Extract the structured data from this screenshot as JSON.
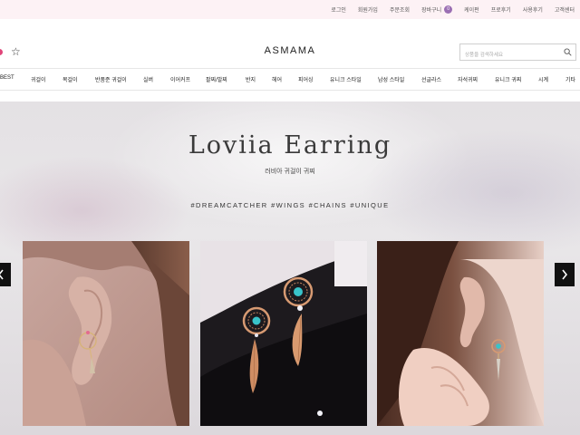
{
  "topbar": {
    "links": [
      "로그인",
      "회원가입",
      "주문조회",
      "장바구니",
      "케이펀",
      "프로후기",
      "사용후기",
      "고객센터"
    ],
    "cart_count": "0"
  },
  "header": {
    "logo": "ASMAMA",
    "search_placeholder": "상품을 검색하세요"
  },
  "nav": {
    "items": [
      "BEST",
      "귀걸이",
      "목걸이",
      "반품준 귀걸이",
      "실버",
      "이어커프",
      "팔찌/발찌",
      "반지",
      "헤어",
      "피어싱",
      "유니크 스타일",
      "남성 스타일",
      "선글라스",
      "자석귀찌",
      "유니크 귀찌",
      "시계",
      "기타"
    ]
  },
  "hero": {
    "title": "Loviia Earring",
    "subtitle": "러비아 귀걸이 귀찌",
    "tags": "#DREAMCATCHER  #WINGS  #CHAINS  #UNIQUE"
  },
  "icons": {
    "wishlist": "star-icon",
    "search": "search-icon",
    "prev": "chevron-left-icon",
    "next": "chevron-right-icon"
  },
  "colors": {
    "topbar_bg": "#fdf2f5",
    "cart_badge": "#9b6fb3",
    "accent_pink": "#e0457a",
    "slider_arrow": "#111111"
  }
}
